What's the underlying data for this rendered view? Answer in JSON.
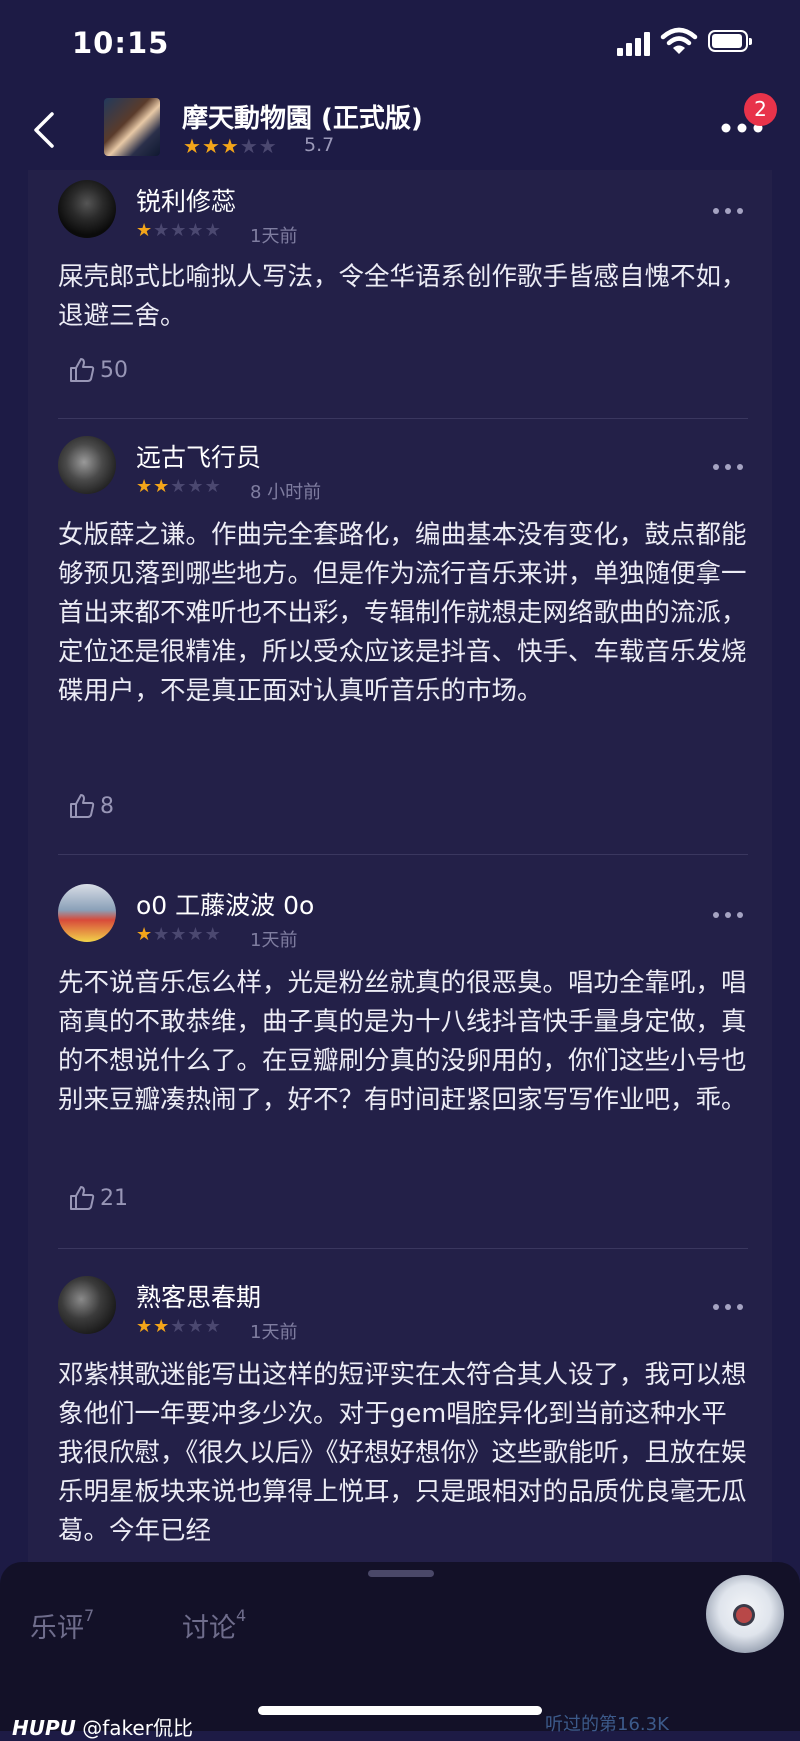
{
  "status_bar": {
    "time": "10:15"
  },
  "header": {
    "title": "摩天動物園 (正式版)",
    "stars": 3,
    "rating": "5.7",
    "badge_count": "2"
  },
  "reviews": [
    {
      "user": "锐利修蕊",
      "stars": 1,
      "time": "1天前",
      "text": "屎壳郎式比喻拟人写法，令全华语系创作歌手皆感自愧不如，退避三舍。",
      "likes": "50"
    },
    {
      "user": "远古飞行员",
      "stars": 2,
      "time": "8 小时前",
      "text": "女版薛之谦。作曲完全套路化，编曲基本没有变化，鼓点都能够预见落到哪些地方。但是作为流行音乐来讲，单独随便拿一首出来都不难听也不出彩，专辑制作就想走网络歌曲的流派，定位还是很精准，所以受众应该是抖音、快手、车载音乐发烧碟用户，不是真正面对认真听音乐的市场。",
      "likes": "8"
    },
    {
      "user": "o0 工藤波波 0o",
      "stars": 1,
      "time": "1天前",
      "text": "先不说音乐怎么样，光是粉丝就真的很恶臭。唱功全靠吼，唱商真的不敢恭维，曲子真的是为十八线抖音快手量身定做，真的不想说什么了。在豆瓣刷分真的没卵用的，你们这些小号也别来豆瓣凑热闹了，好不？有时间赶紧回家写写作业吧，乖。",
      "likes": "21"
    },
    {
      "user": "熟客思春期",
      "stars": 2,
      "time": "1天前",
      "text": "邓紫棋歌迷能写出这样的短评实在太符合其人设了，我可以想象他们一年要冲多少次。对于gem唱腔异化到当前这种水平我很欣慰，《很久以后》《好想好想你》这些歌能听，且放在娱乐明星板块来说也算得上悦耳，只是跟相对的品质优良毫无瓜葛。今年已经",
      "likes": ""
    }
  ],
  "bottom_tabs": [
    {
      "label": "乐评",
      "count": "7"
    },
    {
      "label": "讨论",
      "count": "4"
    }
  ],
  "watermark": {
    "brand": "HUPU",
    "handle": "@faker侃比"
  },
  "peek_text": "听过的第16.3K"
}
